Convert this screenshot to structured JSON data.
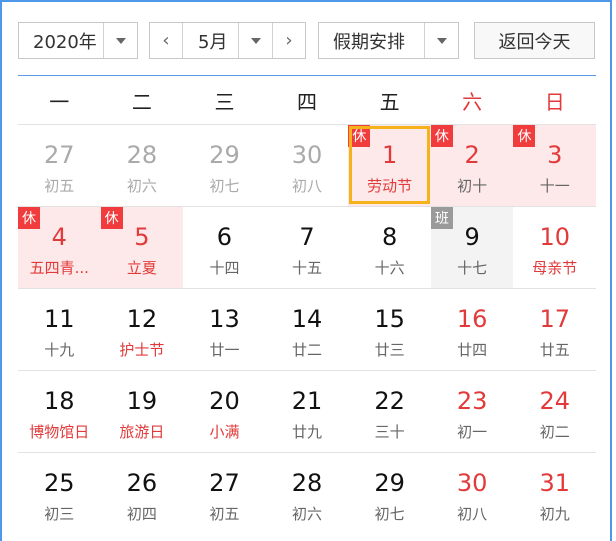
{
  "toolbar": {
    "year": "2020年",
    "month": "5月",
    "holiday_select": "假期安排",
    "today_button": "返回今天",
    "prev_icon": "‹",
    "next_icon": "›"
  },
  "weekdays": [
    "一",
    "二",
    "三",
    "四",
    "五",
    "六",
    "日"
  ],
  "weeks": [
    [
      {
        "day": "27",
        "sub": "初五",
        "state": "other"
      },
      {
        "day": "28",
        "sub": "初六",
        "state": "other"
      },
      {
        "day": "29",
        "sub": "初七",
        "state": "other"
      },
      {
        "day": "30",
        "sub": "初八",
        "state": "other"
      },
      {
        "day": "1",
        "sub": "劳动节",
        "state": "rest",
        "tag": "休",
        "selected": true,
        "holiday": true
      },
      {
        "day": "2",
        "sub": "初十",
        "state": "rest",
        "tag": "休"
      },
      {
        "day": "3",
        "sub": "十一",
        "state": "rest",
        "tag": "休"
      }
    ],
    [
      {
        "day": "4",
        "sub": "五四青...",
        "state": "rest",
        "tag": "休",
        "holiday": true
      },
      {
        "day": "5",
        "sub": "立夏",
        "state": "rest",
        "tag": "休",
        "holiday": true
      },
      {
        "day": "6",
        "sub": "十四"
      },
      {
        "day": "7",
        "sub": "十五"
      },
      {
        "day": "8",
        "sub": "十六"
      },
      {
        "day": "9",
        "sub": "十七",
        "state": "work",
        "tag": "班"
      },
      {
        "day": "10",
        "sub": "母亲节",
        "weekend": true,
        "holiday": true
      }
    ],
    [
      {
        "day": "11",
        "sub": "十九"
      },
      {
        "day": "12",
        "sub": "护士节",
        "holiday": true
      },
      {
        "day": "13",
        "sub": "廿一"
      },
      {
        "day": "14",
        "sub": "廿二"
      },
      {
        "day": "15",
        "sub": "廿三"
      },
      {
        "day": "16",
        "sub": "廿四",
        "weekend": true
      },
      {
        "day": "17",
        "sub": "廿五",
        "weekend": true
      }
    ],
    [
      {
        "day": "18",
        "sub": "博物馆日",
        "holiday": true
      },
      {
        "day": "19",
        "sub": "旅游日",
        "holiday": true
      },
      {
        "day": "20",
        "sub": "小满",
        "holiday": true
      },
      {
        "day": "21",
        "sub": "廿九"
      },
      {
        "day": "22",
        "sub": "三十"
      },
      {
        "day": "23",
        "sub": "初一",
        "weekend": true
      },
      {
        "day": "24",
        "sub": "初二",
        "weekend": true
      }
    ],
    [
      {
        "day": "25",
        "sub": "初三"
      },
      {
        "day": "26",
        "sub": "初四"
      },
      {
        "day": "27",
        "sub": "初五"
      },
      {
        "day": "28",
        "sub": "初六"
      },
      {
        "day": "29",
        "sub": "初七"
      },
      {
        "day": "30",
        "sub": "初八",
        "weekend": true
      },
      {
        "day": "31",
        "sub": "初九",
        "weekend": true
      }
    ]
  ]
}
